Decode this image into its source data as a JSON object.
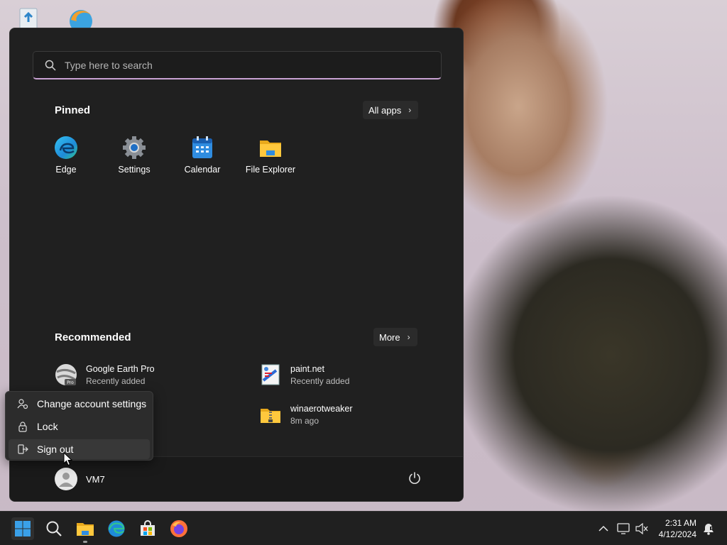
{
  "desktop": {
    "icons": [
      {
        "name": "recycle-bin-icon"
      },
      {
        "name": "browser-desktop-icon"
      }
    ]
  },
  "start_menu": {
    "search": {
      "placeholder": "Type here to search"
    },
    "pinned": {
      "title": "Pinned",
      "all_apps_label": "All apps",
      "apps": [
        {
          "label": "Edge",
          "icon": "edge-icon"
        },
        {
          "label": "Settings",
          "icon": "settings-gear-icon"
        },
        {
          "label": "Calendar",
          "icon": "calendar-icon"
        },
        {
          "label": "File Explorer",
          "icon": "folder-icon"
        }
      ]
    },
    "recommended": {
      "title": "Recommended",
      "more_label": "More",
      "items": [
        {
          "name": "Google Earth Pro",
          "sub": "Recently added",
          "icon": "google-earth-pro-icon"
        },
        {
          "name": "paint.net",
          "sub": "Recently added",
          "icon": "paint-net-icon"
        },
        {
          "name": "winaerotweaker",
          "sub": "8m ago",
          "icon": "zip-folder-icon"
        }
      ]
    },
    "account_menu": {
      "items": [
        {
          "label": "Change account settings",
          "icon": "account-settings-icon"
        },
        {
          "label": "Lock",
          "icon": "lock-icon"
        },
        {
          "label": "Sign out",
          "icon": "sign-out-icon"
        }
      ]
    },
    "user": {
      "name": "VM7"
    }
  },
  "taskbar": {
    "apps": [
      "start-icon",
      "search-icon",
      "file-explorer-icon",
      "edge-icon",
      "store-icon",
      "firefox-icon"
    ],
    "clock": {
      "time": "2:31 AM",
      "date": "4/12/2024"
    }
  },
  "colors": {
    "accent": "#c9a2d3",
    "menu_bg": "#202020",
    "taskbar_bg": "#202020"
  }
}
